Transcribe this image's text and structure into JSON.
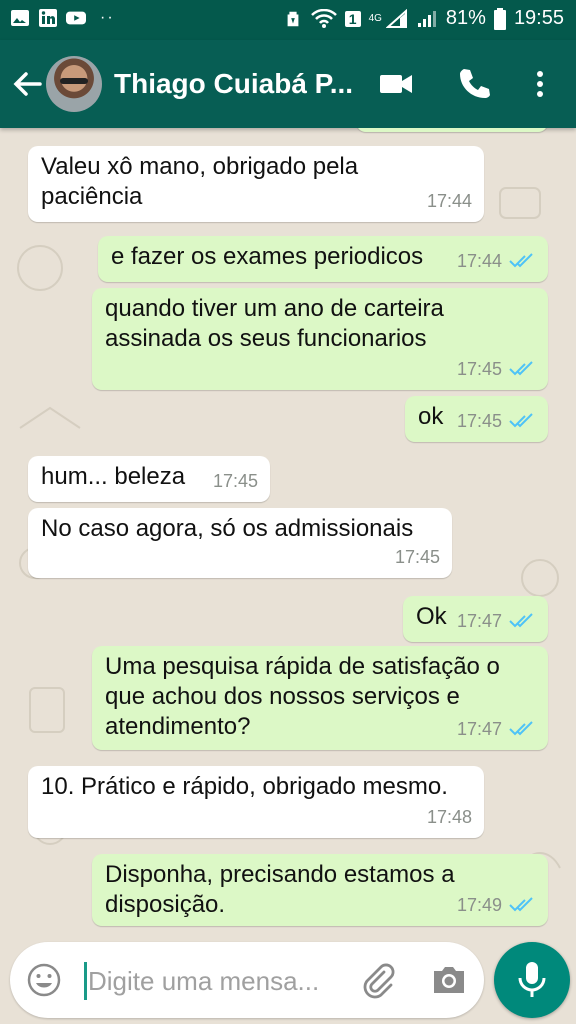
{
  "status_bar": {
    "battery": "81%",
    "time": "19:55",
    "network": "4G",
    "sim": "1"
  },
  "header": {
    "contact_name": "Thiago Cuiabá P..."
  },
  "messages": [
    {
      "dir": "in",
      "text": "Valeu xô mano, obrigado pela paciência",
      "time": "17:44"
    },
    {
      "dir": "out",
      "text": "e fazer os exames periodicos",
      "time": "17:44"
    },
    {
      "dir": "out",
      "text": "quando tiver um ano de carteira assinada os seus funcionarios",
      "time": "17:45"
    },
    {
      "dir": "out",
      "text": "ok",
      "time": "17:45"
    },
    {
      "dir": "in",
      "text": "hum... beleza",
      "time": "17:45"
    },
    {
      "dir": "in",
      "text": "No caso agora, só os admissionais",
      "time": "17:45"
    },
    {
      "dir": "out",
      "text": "Ok",
      "time": "17:47"
    },
    {
      "dir": "out",
      "text": "Uma pesquisa rápida de satisfação o que achou dos nossos serviços e atendimento?",
      "time": "17:47"
    },
    {
      "dir": "in",
      "text": "10. Prático e rápido, obrigado mesmo.",
      "time": "17:48"
    },
    {
      "dir": "out",
      "text": "Disponha, precisando estamos a disposição.",
      "time": "17:49"
    }
  ],
  "composer": {
    "placeholder": "Digite uma mensa..."
  },
  "colors": {
    "header": "#075e54",
    "status_bar": "#04594c",
    "outgoing_bubble": "#dcf8c6",
    "incoming_bubble": "#ffffff",
    "read_ticks": "#4fc3f7",
    "mic_button": "#00897b"
  },
  "icons": {
    "back": "arrow-left-icon",
    "video": "video-call-icon",
    "call": "phone-icon",
    "menu": "more-vert-icon",
    "emoji": "emoji-icon",
    "attach": "paperclip-icon",
    "camera": "camera-icon",
    "mic": "mic-icon"
  }
}
